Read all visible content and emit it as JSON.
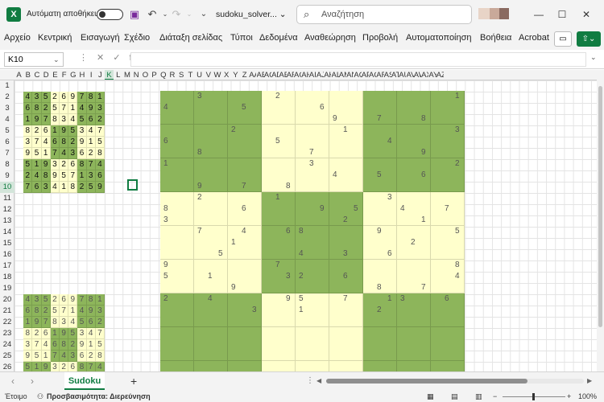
{
  "titlebar": {
    "app_badge": "X",
    "autosave_label": "Αυτόματη αποθήκευση",
    "filename": "sudoku_solver... ⌄",
    "search_placeholder": "Αναζήτηση",
    "search_icon": "search-icon"
  },
  "menu": [
    "Αρχείο",
    "Κεντρική",
    "Εισαγωγή",
    "Σχέδιο",
    "Διάταξη σελίδας",
    "Τύποι",
    "Δεδομένα",
    "Αναθεώρηση",
    "Προβολή",
    "Αυτοματοποίηση",
    "Βοήθεια",
    "Acrobat"
  ],
  "formula_bar": {
    "name_box": "K10",
    "fx_icons": "⋮ ✕ ✓ fx",
    "formula": ""
  },
  "columns": [
    "A",
    "B",
    "C",
    "D",
    "E",
    "F",
    "G",
    "H",
    "I",
    "J",
    "K",
    "L",
    "M",
    "N",
    "O",
    "P",
    "Q",
    "R",
    "S",
    "T",
    "U",
    "V",
    "W",
    "X",
    "Y",
    "Z",
    "AA",
    "AB",
    "AC",
    "AD",
    "AE",
    "AF",
    "AG",
    "AH",
    "AI",
    "AJ",
    "AK",
    "AL",
    "AM",
    "AN",
    "AO",
    "AP",
    "AQ",
    "AR",
    "AS",
    "AT",
    "AU",
    "AV",
    "AW",
    "AX",
    "AY",
    "AZ"
  ],
  "rows": [
    "1",
    "2",
    "3",
    "4",
    "5",
    "6",
    "7",
    "8",
    "9",
    "10",
    "11",
    "12",
    "13",
    "14",
    "15",
    "16",
    "17",
    "18",
    "19",
    "20",
    "21",
    "22",
    "23",
    "24",
    "25",
    "26"
  ],
  "selected_cell": {
    "column": "K",
    "row": "10"
  },
  "solved_grid": [
    [
      "4",
      "3",
      "5",
      "2",
      "6",
      "9",
      "7",
      "8",
      "1"
    ],
    [
      "6",
      "8",
      "2",
      "5",
      "7",
      "1",
      "4",
      "9",
      "3"
    ],
    [
      "1",
      "9",
      "7",
      "8",
      "3",
      "4",
      "5",
      "6",
      "2"
    ],
    [
      "8",
      "2",
      "6",
      "1",
      "9",
      "5",
      "3",
      "4",
      "7"
    ],
    [
      "3",
      "7",
      "4",
      "6",
      "8",
      "2",
      "9",
      "1",
      "5"
    ],
    [
      "9",
      "5",
      "1",
      "7",
      "4",
      "3",
      "6",
      "2",
      "8"
    ],
    [
      "5",
      "1",
      "9",
      "3",
      "2",
      "6",
      "8",
      "7",
      "4"
    ],
    [
      "2",
      "4",
      "8",
      "9",
      "5",
      "7",
      "1",
      "3",
      "6"
    ],
    [
      "7",
      "6",
      "3",
      "4",
      "1",
      "8",
      "2",
      "5",
      "9"
    ]
  ],
  "lower_grid_rows": [
    [
      "4",
      "3",
      "5",
      "2",
      "6",
      "9",
      "7",
      "8",
      "1"
    ],
    [
      "6",
      "8",
      "2",
      "5",
      "7",
      "1",
      "4",
      "9",
      "3"
    ],
    [
      "1",
      "9",
      "7",
      "8",
      "3",
      "4",
      "5",
      "6",
      "2"
    ],
    [
      "8",
      "2",
      "6",
      "1",
      "9",
      "5",
      "3",
      "4",
      "7"
    ],
    [
      "3",
      "7",
      "4",
      "6",
      "8",
      "2",
      "9",
      "1",
      "5"
    ],
    [
      "9",
      "5",
      "1",
      "7",
      "4",
      "3",
      "6",
      "2",
      "8"
    ],
    [
      "5",
      "1",
      "9",
      "3",
      "2",
      "6",
      "8",
      "7",
      "4"
    ]
  ],
  "board_hints": [
    {
      "r": 0,
      "c": 1,
      "t": "3"
    },
    {
      "r": 0,
      "c": 3,
      "t": "2"
    },
    {
      "r": 0,
      "c": 8,
      "t": "1"
    },
    {
      "r": 1,
      "c": 0,
      "t": "4"
    },
    {
      "r": 1,
      "c": 2,
      "t": "5"
    },
    {
      "r": 1,
      "c": 4,
      "t": "6"
    },
    {
      "r": 2,
      "c": 5,
      "t": "9"
    },
    {
      "r": 2,
      "c": 6,
      "t": "7"
    },
    {
      "r": 2,
      "c": 7,
      "t": "8"
    },
    {
      "r": 3,
      "c": 2,
      "t": "2"
    },
    {
      "r": 3,
      "c": 5,
      "t": "1"
    },
    {
      "r": 3,
      "c": 8,
      "t": "3"
    },
    {
      "r": 4,
      "c": 0,
      "t": "6"
    },
    {
      "r": 4,
      "c": 3,
      "t": "5"
    },
    {
      "r": 4,
      "c": 6,
      "t": "4"
    },
    {
      "r": 5,
      "c": 1,
      "t": "8"
    },
    {
      "r": 5,
      "c": 4,
      "t": "7"
    },
    {
      "r": 5,
      "c": 7,
      "t": "9"
    },
    {
      "r": 6,
      "c": 0,
      "t": "1"
    },
    {
      "r": 6,
      "c": 4,
      "t": "3"
    },
    {
      "r": 6,
      "c": 8,
      "t": "2"
    },
    {
      "r": 7,
      "c": 5,
      "t": "4"
    },
    {
      "r": 7,
      "c": 6,
      "t": "5"
    },
    {
      "r": 7,
      "c": 7,
      "t": "6"
    },
    {
      "r": 8,
      "c": 1,
      "t": "9"
    },
    {
      "r": 8,
      "c": 2,
      "t": "7"
    },
    {
      "r": 8,
      "c": 3,
      "t": "8"
    },
    {
      "r": 9,
      "c": 1,
      "t": "2"
    },
    {
      "r": 9,
      "c": 3,
      "t": "1"
    },
    {
      "r": 9,
      "c": 6,
      "t": "3"
    },
    {
      "r": 10,
      "c": 0,
      "t": "8"
    },
    {
      "r": 10,
      "c": 2,
      "t": "6"
    },
    {
      "r": 10,
      "c": 5,
      "t": "5"
    },
    {
      "r": 10,
      "c": 7,
      "t": "4"
    },
    {
      "r": 10,
      "c": 8,
      "t": "7"
    },
    {
      "r": 10,
      "c": 4,
      "t": "9"
    },
    {
      "r": 11,
      "c": 0,
      "t": "3"
    },
    {
      "r": 11,
      "c": 5,
      "t": "2"
    },
    {
      "r": 11,
      "c": 7,
      "t": "1"
    },
    {
      "r": 12,
      "c": 1,
      "t": "7"
    },
    {
      "r": 12,
      "c": 2,
      "t": "4"
    },
    {
      "r": 12,
      "c": 3,
      "t": "6"
    },
    {
      "r": 12,
      "c": 4,
      "t": "8"
    },
    {
      "r": 12,
      "c": 6,
      "t": "9"
    },
    {
      "r": 12,
      "c": 8,
      "t": "5"
    },
    {
      "r": 13,
      "c": 2,
      "t": "1"
    },
    {
      "r": 13,
      "c": 7,
      "t": "2"
    },
    {
      "r": 14,
      "c": 1,
      "t": "5"
    },
    {
      "r": 14,
      "c": 4,
      "t": "4"
    },
    {
      "r": 14,
      "c": 5,
      "t": "3"
    },
    {
      "r": 14,
      "c": 6,
      "t": "6"
    },
    {
      "r": 15,
      "c": 0,
      "t": "9"
    },
    {
      "r": 15,
      "c": 3,
      "t": "7"
    },
    {
      "r": 15,
      "c": 8,
      "t": "8"
    },
    {
      "r": 16,
      "c": 0,
      "t": "5"
    },
    {
      "r": 16,
      "c": 1,
      "t": "1"
    },
    {
      "r": 16,
      "c": 3,
      "t": "3"
    },
    {
      "r": 16,
      "c": 4,
      "t": "2"
    },
    {
      "r": 16,
      "c": 5,
      "t": "6"
    },
    {
      "r": 16,
      "c": 8,
      "t": "4"
    },
    {
      "r": 17,
      "c": 2,
      "t": "9"
    },
    {
      "r": 17,
      "c": 6,
      "t": "8"
    },
    {
      "r": 17,
      "c": 7,
      "t": "7"
    },
    {
      "r": 18,
      "c": 0,
      "t": "2"
    },
    {
      "r": 18,
      "c": 1,
      "t": "4"
    },
    {
      "r": 18,
      "c": 3,
      "t": "9"
    },
    {
      "r": 18,
      "c": 4,
      "t": "5"
    },
    {
      "r": 18,
      "c": 5,
      "t": "7"
    },
    {
      "r": 18,
      "c": 6,
      "t": "1"
    },
    {
      "r": 18,
      "c": 7,
      "t": "3"
    },
    {
      "r": 18,
      "c": 8,
      "t": "6"
    },
    {
      "r": 19,
      "c": 2,
      "t": "3"
    },
    {
      "r": 19,
      "c": 4,
      "t": "1"
    },
    {
      "r": 19,
      "c": 6,
      "t": "2"
    }
  ],
  "sheet_tab": "Sudoku",
  "status": {
    "ready": "Έτοιμο",
    "accessibility": "Προσβασιμότητα: Διερεύνηση",
    "zoom": "100%"
  },
  "colors": {
    "dark_green": "#8db55b",
    "light_yellow": "#ffffcc",
    "accent": "#107c41"
  }
}
